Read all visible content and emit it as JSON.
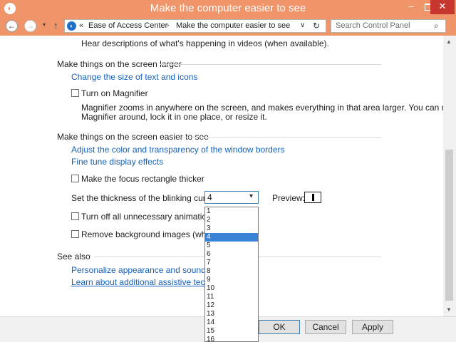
{
  "window": {
    "title": "Make the computer easier to see",
    "minimize": "–",
    "close": "✕"
  },
  "nav": {
    "back": "←",
    "forward": "→",
    "recent": "▾",
    "up": "↑",
    "address_chevron": "«",
    "breadcrumb": [
      "Ease of Access Center",
      "Make the computer easier to see"
    ],
    "breadcrumb_sep": "›",
    "address_dropdown": "∨",
    "refresh": "↻",
    "search_placeholder": "Search Control Panel"
  },
  "content": {
    "top_text": "Hear descriptions of what's happening in videos (when available).",
    "section_larger": {
      "heading": "Make things on the screen larger",
      "link": "Change the size of text and icons",
      "magnifier_label": "Turn on Magnifier",
      "magnifier_checked": false,
      "magnifier_desc_line1": "Magnifier zooms in anywhere on the screen, and makes everything in that area larger. You can move",
      "magnifier_desc_line2": "Magnifier around, lock it in one place, or resize it."
    },
    "section_easier": {
      "heading": "Make things on the screen easier to see",
      "link1": "Adjust the color and transparency of the window borders",
      "link2": "Fine tune display effects",
      "focus_label": "Make the focus rectangle thicker",
      "focus_checked": false,
      "cursor_label": "Set the thickness of the blinking cursor:",
      "cursor_value": "4",
      "preview_label": "Preview:",
      "animations_label": "Turn off all unnecessary animations (whe",
      "animations_checked": false,
      "background_label": "Remove background images (where avail",
      "background_checked": false
    },
    "see_also": {
      "heading": "See also",
      "link1": "Personalize appearance and sound effects",
      "link2": "Learn about additional assistive technologie"
    }
  },
  "dropdown": {
    "options": [
      "1",
      "2",
      "3",
      "4",
      "5",
      "6",
      "7",
      "8",
      "9",
      "10",
      "11",
      "12",
      "13",
      "14",
      "15",
      "16"
    ],
    "selected": "4"
  },
  "buttons": {
    "ok": "OK",
    "cancel": "Cancel",
    "apply": "Apply"
  },
  "colors": {
    "accent": "#f0956a",
    "link": "#1561b9",
    "selection": "#3a82d6"
  }
}
